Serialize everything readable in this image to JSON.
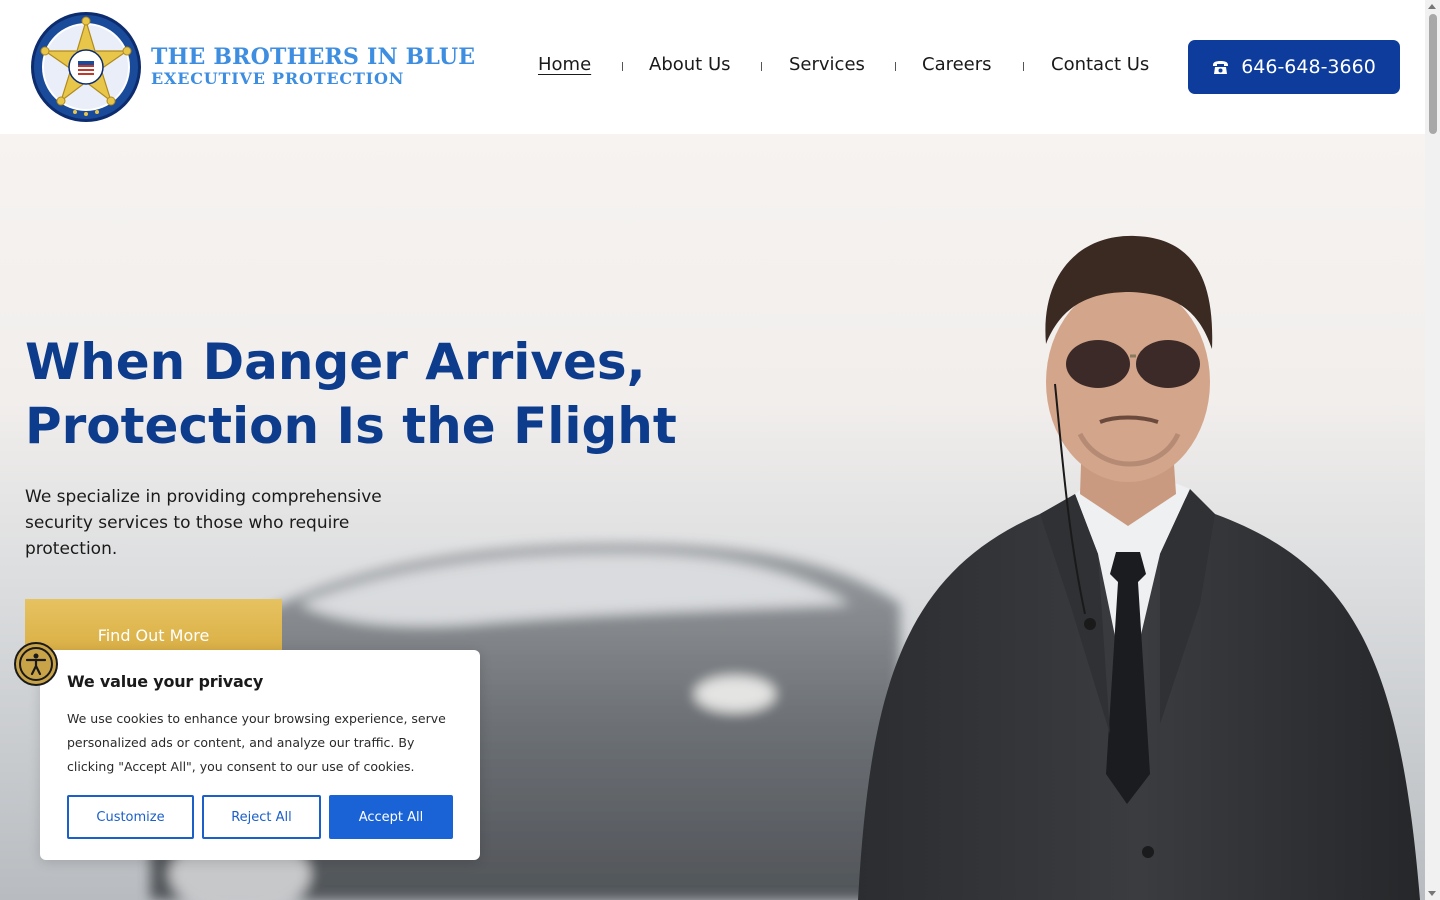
{
  "header": {
    "logo_line1": "THE BROTHERS IN BLUE",
    "logo_line2": "EXECUTIVE PROTECTION",
    "nav": [
      "Home",
      "About Us",
      "Services",
      "Careers",
      "Contact Us"
    ],
    "active_nav": "Home",
    "phone": "646-648-3660"
  },
  "hero": {
    "title_line1": "When Danger Arrives,",
    "title_line2": "Protection Is the Flight",
    "subtitle": "We specialize in providing comprehensive security services to those who require protection.",
    "cta_label": "Find Out More"
  },
  "cookie": {
    "title": "We value your privacy",
    "body": "We use cookies to enhance your browsing experience, serve personalized ads or content, and analyze our traffic. By clicking \"Accept All\", you consent to our use of cookies.",
    "customize": "Customize",
    "reject": "Reject All",
    "accept": "Accept All"
  },
  "colors": {
    "brand_blue": "#0d3c9c",
    "logo_blue": "#3d8de0",
    "cta_gold": "#d6a93c",
    "cookie_blue": "#1a63d6"
  },
  "icons": {
    "phone": "phone-icon",
    "accessibility": "accessibility-icon",
    "logo": "star-badge-icon"
  }
}
